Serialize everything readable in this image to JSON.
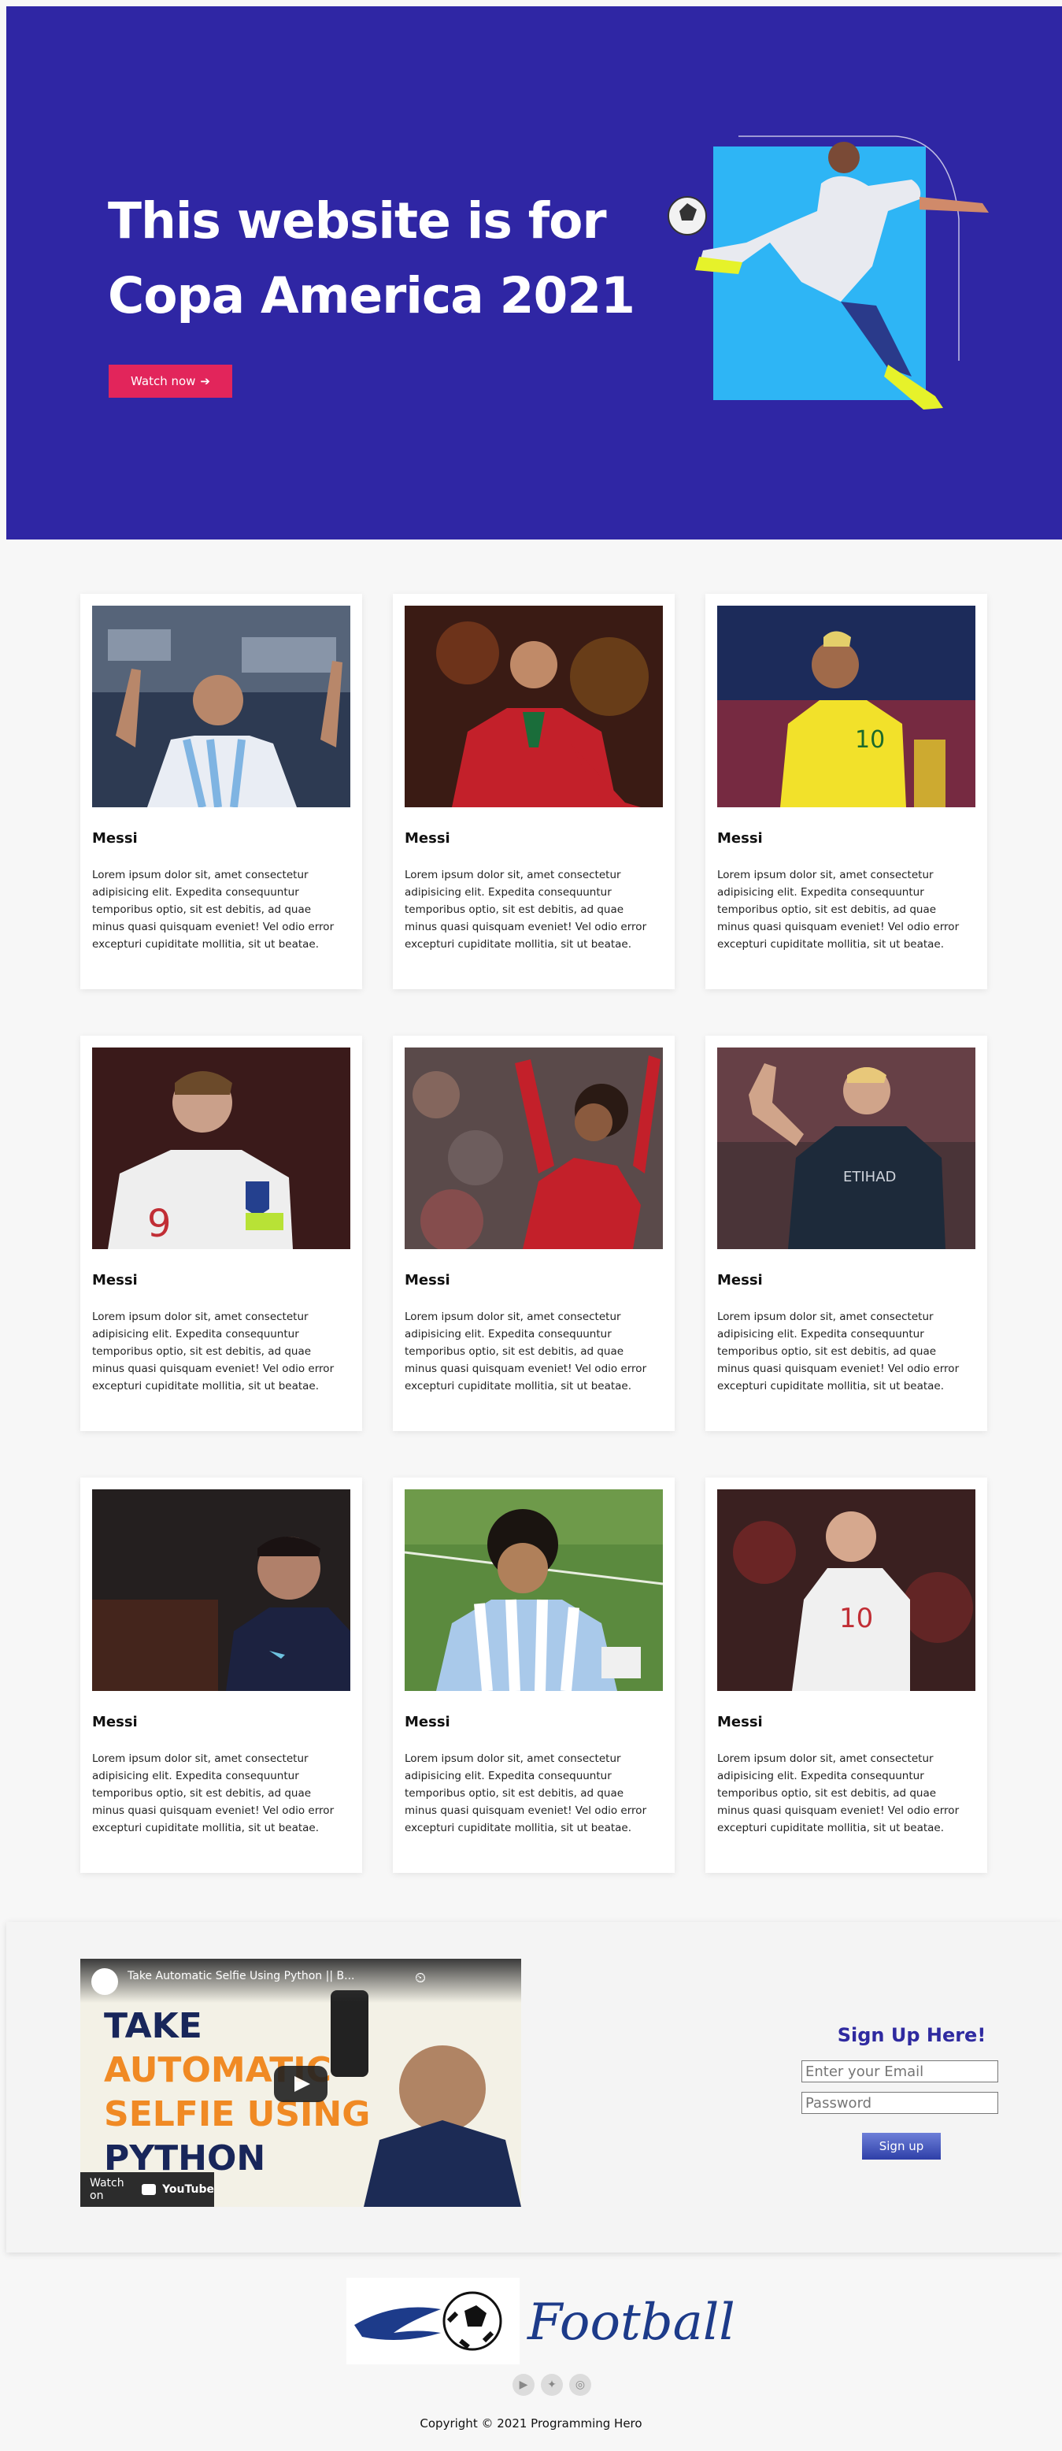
{
  "hero": {
    "title_line1": "This website is for",
    "title_line2": "Copa America 2021",
    "button_label": "Watch now",
    "button_icon": "arrow-right-icon",
    "colors": {
      "background": "#2f26a4",
      "button": "#e2255b",
      "accent": "#2eb5f5"
    }
  },
  "cards": [
    {
      "name": "Messi",
      "description": "Lorem ipsum dolor sit, amet consectetur adipisicing elit. Expedita consequuntur temporibus optio, sit est debitis, ad quae minus quasi quisquam eveniet! Vel odio error excepturi cupiditate mollitia, sit ut beatae."
    },
    {
      "name": "Messi",
      "description": "Lorem ipsum dolor sit, amet consectetur adipisicing elit. Expedita consequuntur temporibus optio, sit est debitis, ad quae minus quasi quisquam eveniet! Vel odio error excepturi cupiditate mollitia, sit ut beatae."
    },
    {
      "name": "Messi",
      "description": "Lorem ipsum dolor sit, amet consectetur adipisicing elit. Expedita consequuntur temporibus optio, sit est debitis, ad quae minus quasi quisquam eveniet! Vel odio error excepturi cupiditate mollitia, sit ut beatae."
    },
    {
      "name": "Messi",
      "description": "Lorem ipsum dolor sit, amet consectetur adipisicing elit. Expedita consequuntur temporibus optio, sit est debitis, ad quae minus quasi quisquam eveniet! Vel odio error excepturi cupiditate mollitia, sit ut beatae."
    },
    {
      "name": "Messi",
      "description": "Lorem ipsum dolor sit, amet consectetur adipisicing elit. Expedita consequuntur temporibus optio, sit est debitis, ad quae minus quasi quisquam eveniet! Vel odio error excepturi cupiditate mollitia, sit ut beatae."
    },
    {
      "name": "Messi",
      "description": "Lorem ipsum dolor sit, amet consectetur adipisicing elit. Expedita consequuntur temporibus optio, sit est debitis, ad quae minus quasi quisquam eveniet! Vel odio error excepturi cupiditate mollitia, sit ut beatae."
    },
    {
      "name": "Messi",
      "description": "Lorem ipsum dolor sit, amet consectetur adipisicing elit. Expedita consequuntur temporibus optio, sit est debitis, ad quae minus quasi quisquam eveniet! Vel odio error excepturi cupiditate mollitia, sit ut beatae."
    },
    {
      "name": "Messi",
      "description": "Lorem ipsum dolor sit, amet consectetur adipisicing elit. Expedita consequuntur temporibus optio, sit est debitis, ad quae minus quasi quisquam eveniet! Vel odio error excepturi cupiditate mollitia, sit ut beatae."
    },
    {
      "name": "Messi",
      "description": "Lorem ipsum dolor sit, amet consectetur adipisicing elit. Expedita consequuntur temporibus optio, sit est debitis, ad quae minus quasi quisquam eveniet! Vel odio error excepturi cupiditate mollitia, sit ut beatae."
    }
  ],
  "video": {
    "title": "Take Automatic Selfie Using Python || B...",
    "headline_line1": "TAKE",
    "headline_line2": "AUTOMATIC",
    "headline_line3": "SELFIE USING",
    "headline_line4": "PYTHON",
    "watch_on": "Watch on",
    "platform": "YouTube",
    "play_icon": "play-icon"
  },
  "signup": {
    "title": "Sign Up Here!",
    "email_placeholder": "Enter your Email",
    "password_placeholder": "Password",
    "button_label": "Sign up"
  },
  "footer": {
    "logo_text": "Football",
    "socials": [
      "youtube-icon",
      "twitter-icon",
      "instagram-icon"
    ],
    "copyright": "Copyright © 2021 Programming Hero"
  }
}
